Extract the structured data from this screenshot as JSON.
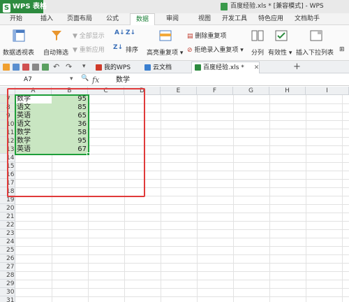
{
  "titlebar": {
    "app_name": "WPS 表格",
    "app_logo_letter": "S",
    "window_title": "百度经验.xls * [兼容模式] - WPS"
  },
  "ribbon_tabs": [
    "开始",
    "插入",
    "页面布局",
    "公式",
    "数据",
    "审阅",
    "视图",
    "开发工具",
    "特色应用",
    "文档助手"
  ],
  "active_tab": "数据",
  "ribbon": {
    "pivot_table": "数据透视表",
    "auto_filter": "自动筛选",
    "show_all": "全部显示",
    "reapply": "重新应用",
    "sort": "排序",
    "highlight_duplicates": "高亮重复项",
    "remove_duplicates": "删除重复项",
    "reject_duplicates": "拒绝录入重复项",
    "split": "分列",
    "validity": "有效性",
    "insert_dropdown": "插入下拉列表"
  },
  "doc_tabs": [
    {
      "label": "我的WPS",
      "icon": "wps-logo-icon"
    },
    {
      "label": "云文档",
      "icon": "cloud-doc-icon"
    },
    {
      "label": "百度经验.xls *",
      "icon": "sheet-doc-icon",
      "active": true
    }
  ],
  "formula_bar": {
    "name_box": "A7",
    "fx_label": "fx",
    "content": "数学"
  },
  "grid": {
    "columns": [
      "A",
      "B",
      "C",
      "D",
      "E",
      "F",
      "G",
      "H",
      "I"
    ],
    "rows": [
      "7",
      "8",
      "9",
      "10",
      "11",
      "12",
      "13",
      "14",
      "15",
      "16",
      "17",
      "18",
      "19",
      "20",
      "21",
      "22",
      "23",
      "24",
      "25",
      "26",
      "27",
      "28",
      "29",
      "30",
      "31"
    ],
    "data": [
      {
        "subject": "数学",
        "score": "95"
      },
      {
        "subject": "语文",
        "score": "85"
      },
      {
        "subject": "英语",
        "score": "65"
      },
      {
        "subject": "语文",
        "score": "36"
      },
      {
        "subject": "数学",
        "score": "58"
      },
      {
        "subject": "数学",
        "score": "95"
      },
      {
        "subject": "英语",
        "score": "67"
      }
    ]
  },
  "colors": {
    "brand_green": "#2d8b3f",
    "selection_fill": "#c9e6c2",
    "selection_border": "#1e9e3a",
    "highlight_box": "#e03a3a"
  }
}
